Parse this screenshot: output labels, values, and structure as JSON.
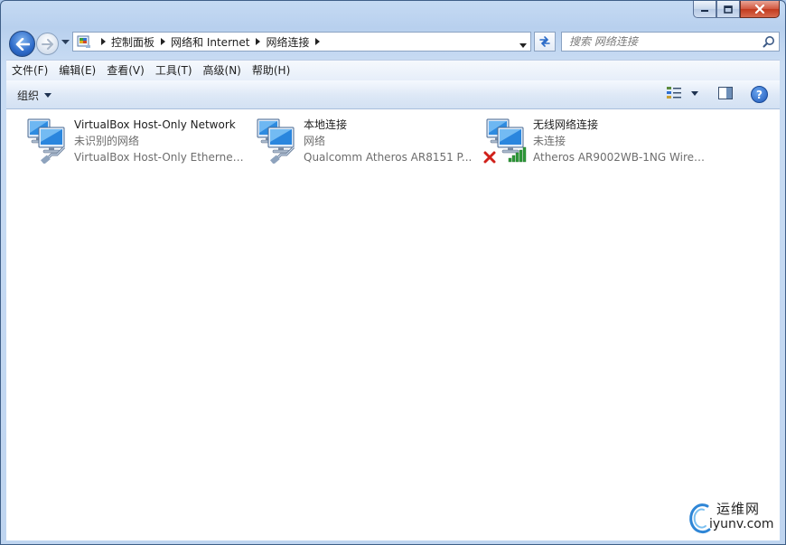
{
  "window": {
    "caption_buttons": [
      "minimize-icon",
      "maximize-icon",
      "close-icon"
    ]
  },
  "nav": {
    "breadcrumb": [
      {
        "label": "控制面板"
      },
      {
        "label": "网络和 Internet"
      },
      {
        "label": "网络连接"
      }
    ],
    "search_placeholder": "搜索 网络连接"
  },
  "menubar": {
    "items": [
      "文件(F)",
      "编辑(E)",
      "查看(V)",
      "工具(T)",
      "高级(N)",
      "帮助(H)"
    ]
  },
  "commandbar": {
    "organize_label": "组织",
    "help_label": "?"
  },
  "connections": [
    {
      "name": "VirtualBox Host-Only Network",
      "status": "未识别的网络",
      "device": "VirtualBox Host-Only Ethernet ...",
      "type": "wired"
    },
    {
      "name": "本地连接",
      "status": "网络",
      "device": "Qualcomm Atheros AR8151 P...",
      "type": "wired"
    },
    {
      "name": "无线网络连接",
      "status": "未连接",
      "device": "Atheros AR9002WB-1NG Wirel...",
      "type": "wireless-disconnected"
    }
  ],
  "watermark": {
    "cn": "运维网",
    "en": "iyunv.com"
  },
  "colors": {
    "frame": "#bfd5f0",
    "accent_blue": "#2d6ac9",
    "close_red": "#c23a1e",
    "secondary_text": "#6d6d6d"
  }
}
